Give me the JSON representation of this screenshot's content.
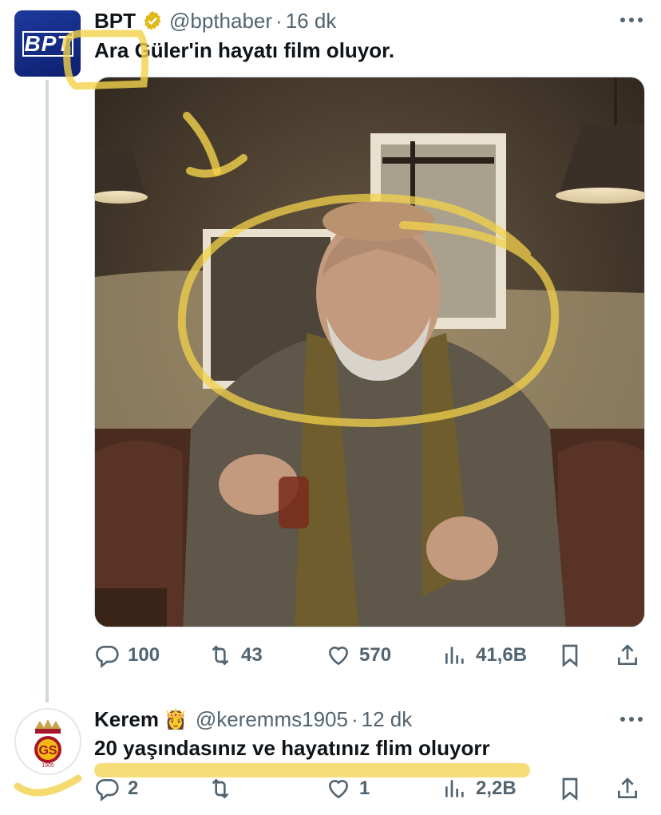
{
  "tweet": {
    "author_name": "BPT",
    "handle": "@bpthaber",
    "separator": "·",
    "time": "16 dk",
    "text": "Ara Güler'in hayatı film oluyor.",
    "avatar_logo": "BPT",
    "verified_icon": "verified-gold-badge-icon",
    "actions": {
      "replies": "100",
      "retweets": "43",
      "likes": "570",
      "views": "41,6B"
    }
  },
  "reply": {
    "author_name": "Kerem",
    "emoji": "👸",
    "handle": "@keremms1905",
    "separator": "·",
    "time": "12 dk",
    "text": "20 yaşındasınız ve hayatınız flim oluyorr",
    "avatar_text": "1905",
    "actions": {
      "replies": "2",
      "retweets": "",
      "likes": "1",
      "views": "2,2B"
    }
  },
  "colors": {
    "text": "#0f1419",
    "muted": "#536471",
    "verified": "#e2b719",
    "annotation": "#f3d24b",
    "thread_line": "#cfd9de"
  }
}
